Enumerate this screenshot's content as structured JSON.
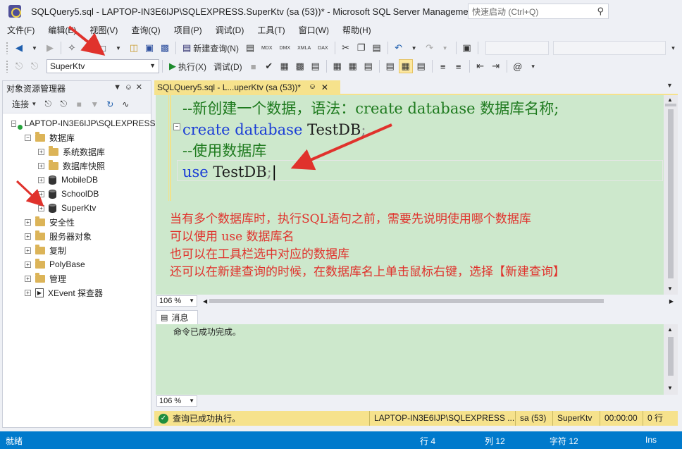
{
  "window": {
    "title": "SQLQuery5.sql - LAPTOP-IN3E6IJP\\SQLEXPRESS.SuperKtv (sa (53))* - Microsoft SQL Server Management...",
    "quick_launch_placeholder": "快速启动 (Ctrl+Q)"
  },
  "menu": [
    "文件(F)",
    "编辑(E)",
    "视图(V)",
    "查询(Q)",
    "项目(P)",
    "调试(D)",
    "工具(T)",
    "窗口(W)",
    "帮助(H)"
  ],
  "toolbar1": {
    "new_query": "新建查询(N)",
    "mdx": "MDX",
    "dmx": "DMX",
    "xmla": "XMLA",
    "dax": "DAX"
  },
  "toolbar2": {
    "database": "SuperKtv",
    "execute": "执行(X)",
    "debug": "调试(D)"
  },
  "object_explorer": {
    "title": "对象资源管理器",
    "connect": "连接",
    "server": "LAPTOP-IN3E6IJP\\SQLEXPRESS",
    "nodes": {
      "databases": "数据库",
      "system_databases": "系统数据库",
      "snapshots": "数据库快照",
      "mobile": "MobileDB",
      "school": "SchoolDB",
      "superktv": "SuperKtv",
      "security": "安全性",
      "server_objects": "服务器对象",
      "replication": "复制",
      "polybase": "PolyBase",
      "management": "管理",
      "xevent": "XEvent 探查器"
    }
  },
  "editor": {
    "tab_title": "SQLQuery5.sql - L...uperKtv (sa (53))*",
    "lines": {
      "l1": "--新创建一个数据，语法：create database 数据库名称;",
      "l2_kw": "create database",
      "l2_id": " TestDB",
      "l2_tail": ";",
      "l3": "--使用数据库",
      "l4_kw": "use",
      "l4_id": " TestDB",
      "l4_tail": ";"
    },
    "notes": [
      "当有多个数据库时，执行SQL语句之前，需要先说明使用哪个数据库",
      "可以使用 use 数据库名",
      "也可以在工具栏选中对应的数据库",
      "还可以在新建查询的时候，在数据库名上单击鼠标右键，选择【新建查询】"
    ],
    "zoom": "106 %"
  },
  "results": {
    "tab": "消息",
    "message": "命令已成功完成。",
    "zoom": "106 %"
  },
  "query_status": {
    "message": "查询已成功执行。",
    "server": "LAPTOP-IN3E6IJP\\SQLEXPRESS ...",
    "user": "sa (53)",
    "database": "SuperKtv",
    "time": "00:00:00",
    "rows": "0 行"
  },
  "status_bar": {
    "ready": "就绪",
    "line": "行 4",
    "col": "列 12",
    "char": "字符 12",
    "mode": "Ins"
  },
  "colors": {
    "annotation_red": "#e0322c",
    "editor_bg": "#cde8cc",
    "accent_yellow": "#f6e28c",
    "status_blue": "#007acc"
  }
}
